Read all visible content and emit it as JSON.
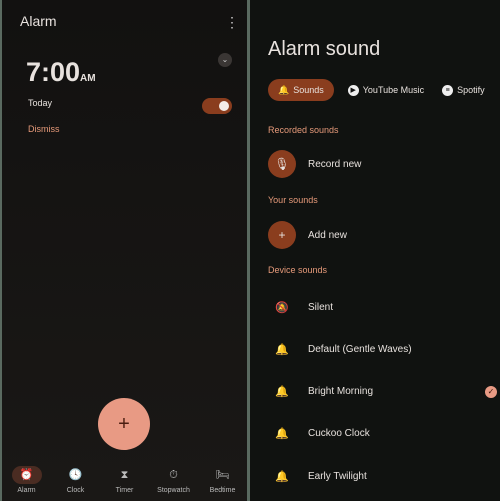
{
  "left": {
    "title": "Alarm",
    "menu_icon": "more-vert-icon",
    "alarm": {
      "time": "7:00",
      "ampm": "AM",
      "day": "Today",
      "enabled": true,
      "dismiss": "Dismiss"
    },
    "fab": "+",
    "nav": [
      {
        "label": "Alarm",
        "icon": "⏰",
        "active": true
      },
      {
        "label": "Clock",
        "icon": "🕓"
      },
      {
        "label": "Timer",
        "icon": "⧗"
      },
      {
        "label": "Stopwatch",
        "icon": "⏱"
      },
      {
        "label": "Bedtime",
        "icon": "🛏"
      }
    ]
  },
  "right": {
    "title": "Alarm sound",
    "tabs": [
      {
        "label": "Sounds",
        "icon": "🔔"
      },
      {
        "label": "YouTube Music",
        "icon": "▶"
      },
      {
        "label": "Spotify",
        "icon": "≡"
      }
    ],
    "recorded_header": "Recorded sounds",
    "record_new": "Record new",
    "your_header": "Your sounds",
    "add_new": "Add new",
    "device_header": "Device sounds",
    "device_sounds": [
      "Silent",
      "Default (Gentle Waves)",
      "Bright Morning",
      "Cuckoo Clock",
      "Early Twilight"
    ],
    "selected": "Bright Morning"
  },
  "colors": {
    "accent": "#8a3d1e",
    "accent_light": "#e69a7a"
  }
}
